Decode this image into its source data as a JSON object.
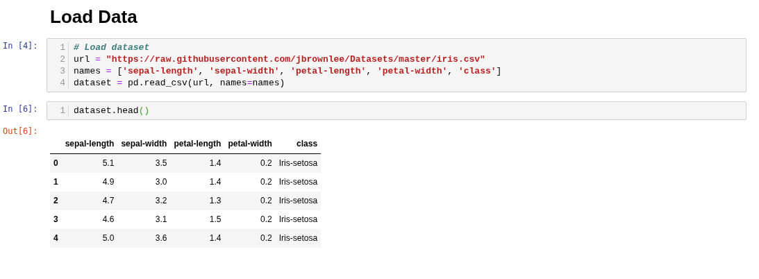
{
  "heading": "Load Data",
  "cells": [
    {
      "prompt": "In [4]:",
      "lines": [
        {
          "number": "1",
          "tokens": [
            {
              "kind": "comment",
              "text": "# Load dataset"
            }
          ]
        },
        {
          "number": "2",
          "tokens": [
            {
              "kind": "plain",
              "text": "url "
            },
            {
              "kind": "operator",
              "text": "="
            },
            {
              "kind": "string",
              "text": " \"https://raw.githubusercontent.com/jbrownlee/Datasets/master/iris.csv\""
            }
          ]
        },
        {
          "number": "3",
          "tokens": [
            {
              "kind": "plain",
              "text": "names "
            },
            {
              "kind": "operator",
              "text": "="
            },
            {
              "kind": "plain",
              "text": " ["
            },
            {
              "kind": "string",
              "text": "'sepal-length'"
            },
            {
              "kind": "plain",
              "text": ", "
            },
            {
              "kind": "string",
              "text": "'sepal-width'"
            },
            {
              "kind": "plain",
              "text": ", "
            },
            {
              "kind": "string",
              "text": "'petal-length'"
            },
            {
              "kind": "plain",
              "text": ", "
            },
            {
              "kind": "string",
              "text": "'petal-width'"
            },
            {
              "kind": "plain",
              "text": ", "
            },
            {
              "kind": "string",
              "text": "'class'"
            },
            {
              "kind": "plain",
              "text": "]"
            }
          ]
        },
        {
          "number": "4",
          "tokens": [
            {
              "kind": "plain",
              "text": "dataset "
            },
            {
              "kind": "operator",
              "text": "="
            },
            {
              "kind": "plain",
              "text": " pd.read_csv(url, names"
            },
            {
              "kind": "operator",
              "text": "="
            },
            {
              "kind": "plain",
              "text": "names)"
            }
          ]
        }
      ]
    },
    {
      "prompt": "In [6]:",
      "lines": [
        {
          "number": "1",
          "tokens": [
            {
              "kind": "plain",
              "text": "dataset.head"
            },
            {
              "kind": "paren",
              "text": "()"
            }
          ]
        }
      ],
      "output": {
        "prompt": "Out[6]:",
        "table": {
          "columns": [
            "",
            "sepal-length",
            "sepal-width",
            "petal-length",
            "petal-width",
            "class"
          ],
          "rows": [
            [
              "0",
              "5.1",
              "3.5",
              "1.4",
              "0.2",
              "Iris-setosa"
            ],
            [
              "1",
              "4.9",
              "3.0",
              "1.4",
              "0.2",
              "Iris-setosa"
            ],
            [
              "2",
              "4.7",
              "3.2",
              "1.3",
              "0.2",
              "Iris-setosa"
            ],
            [
              "3",
              "4.6",
              "3.1",
              "1.5",
              "0.2",
              "Iris-setosa"
            ],
            [
              "4",
              "5.0",
              "3.6",
              "1.4",
              "0.2",
              "Iris-setosa"
            ]
          ]
        }
      }
    }
  ]
}
